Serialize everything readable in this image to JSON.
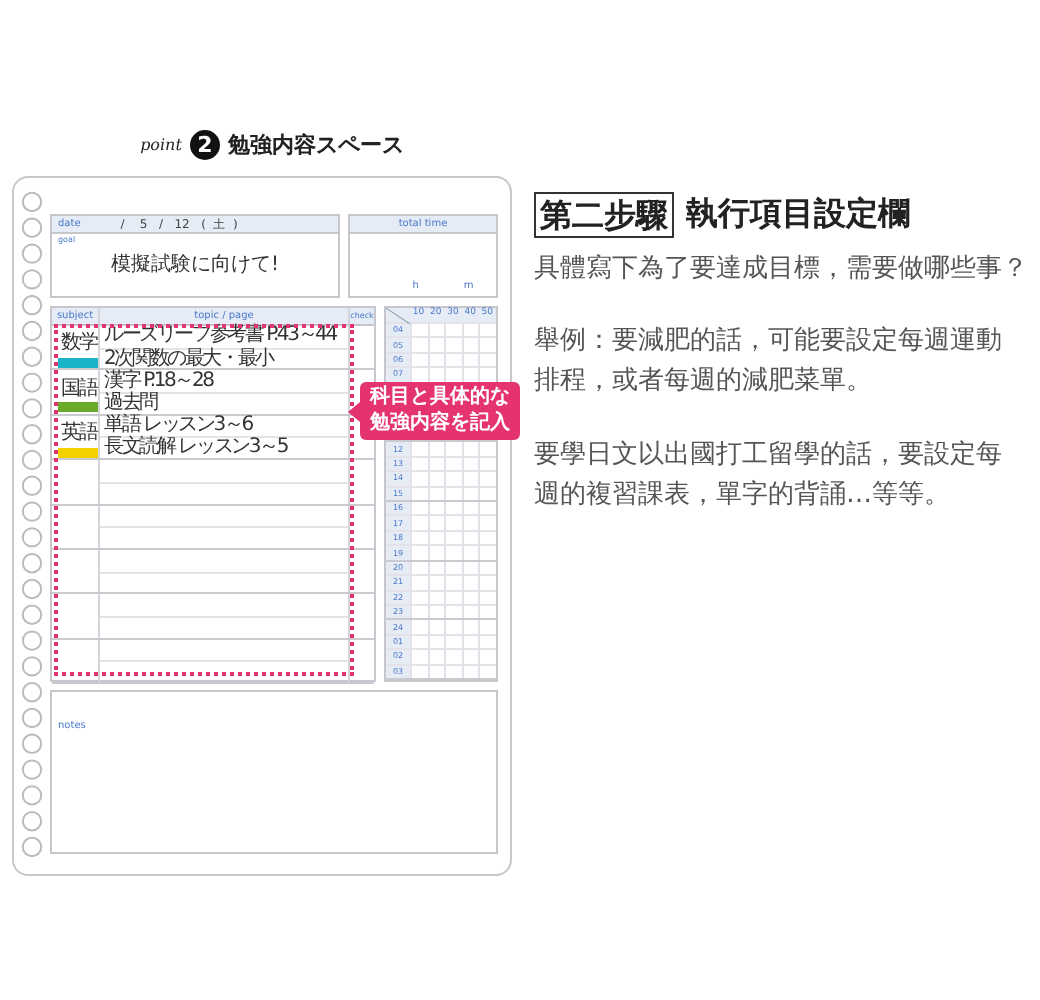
{
  "section_title": {
    "prefix": "point",
    "number": "2",
    "title": "勉強内容スペース"
  },
  "planner": {
    "date": {
      "label": "date",
      "value": "/    5   /   12   (  土  )"
    },
    "goal": {
      "label": "goal",
      "text": "模擬試験に向けて!"
    },
    "total_time": {
      "label": "total time",
      "hours_unit": "h",
      "minutes_unit": "m"
    },
    "study_table": {
      "columns": [
        "subject",
        "topic / page",
        "check"
      ],
      "groups": [
        {
          "subject": "数学",
          "color": "#1bb3c8",
          "topics": [
            "ルーズリーフ参考書 P.43～44",
            "2次関数の最大・最小"
          ]
        },
        {
          "subject": "国語",
          "color": "#6aaa2a",
          "topics": [
            "漢字 P.18～28",
            "過去問"
          ]
        },
        {
          "subject": "英語",
          "color": "#f5d000",
          "topics": [
            "単語 レッスン3～6",
            "長文読解 レッスン3～5"
          ]
        }
      ]
    },
    "time_grid": {
      "minute_marks": [
        "10",
        "20",
        "30",
        "40",
        "50"
      ],
      "hours_above_callout": [
        "04",
        "05",
        "06",
        "07"
      ],
      "hours_below_callout": [
        "12",
        "13",
        "14",
        "15",
        "16",
        "17",
        "18",
        "19",
        "20",
        "21",
        "22",
        "23",
        "24",
        "01",
        "02",
        "03"
      ]
    },
    "callout": [
      "科目と具体的な",
      "勉強内容を記入"
    ],
    "notes": {
      "label": "notes"
    }
  },
  "article": {
    "heading_boxed": "第二步驟",
    "heading": "執行項目設定欄",
    "paragraphs": [
      [
        "具體寫下為了要達成目標，需要做哪些事？"
      ],
      [
        "舉例：要減肥的話，可能要設定每週運動",
        "排程，或者每週的減肥菜單。"
      ],
      [
        "要學日文以出國打工留學的話，要設定每",
        "週的複習課表，單字的背誦…等等。"
      ]
    ]
  }
}
